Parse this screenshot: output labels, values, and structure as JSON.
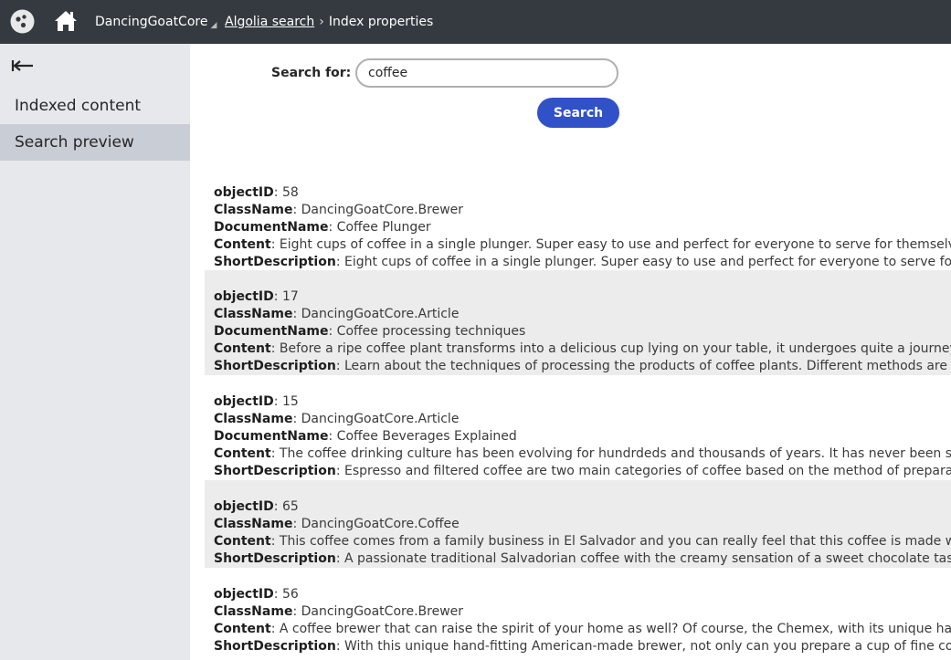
{
  "header": {
    "site": "DancingGoatCore",
    "breadcrumb_link": "Algolia search",
    "breadcrumb_current": "Index properties"
  },
  "sidebar": {
    "back_icon": "back-arrow-icon",
    "items": [
      {
        "label": "Indexed content"
      },
      {
        "label": "Search preview",
        "selected": true
      }
    ]
  },
  "search": {
    "label": "Search for:",
    "value": "coffee",
    "button": "Search"
  },
  "field_labels": {
    "objectID": "objectID",
    "ClassName": "ClassName",
    "DocumentName": "DocumentName",
    "Content": "Content",
    "ShortDescription": "ShortDescription",
    "separator": ": "
  },
  "results": [
    {
      "objectID": "58",
      "ClassName": "DancingGoatCore.Brewer",
      "DocumentName": "Coffee Plunger",
      "Content": "Eight cups of coffee in a single plunger. Super easy to use and perfect for everyone to serve for themselves.",
      "ShortDescription": "Eight cups of coffee in a single plunger. Super easy to use and perfect for everyone to serve for themselves."
    },
    {
      "objectID": "17",
      "ClassName": "DancingGoatCore.Article",
      "DocumentName": "Coffee processing techniques",
      "Content": "Before a ripe coffee plant transforms into a delicious cup lying on your table, it undergoes quite a journey. A journey full c",
      "ShortDescription": "Learn about the techniques of processing the products of coffee plants. Different methods are used in different"
    },
    {
      "objectID": "15",
      "ClassName": "DancingGoatCore.Article",
      "DocumentName": "Coffee Beverages Explained",
      "Content": "The coffee drinking culture has been evolving for hundrdeds and thousands of years. It has never been so rich as today. H",
      "ShortDescription": "Espresso and filtered coffee are two main categories of coffee based on the method of preparation. Learn about"
    },
    {
      "objectID": "65",
      "ClassName": "DancingGoatCore.Coffee",
      "Content": "This coffee comes from a family business in El Salvador and you can really feel that this coffee is made with a passion and",
      "ShortDescription": "A passionate traditional Salvadorian coffee with the creamy sensation of a sweet chocolate taste, suitable for all"
    },
    {
      "objectID": "56",
      "ClassName": "DancingGoatCore.Brewer",
      "Content": "A coffee brewer that can raise the spirit of your home as well? Of course, the Chemex, with its unique hand-fitting shape, t",
      "ShortDescription": "With this unique hand-fitting American-made brewer, not only can you prepare a cup of fine coffee, but you also"
    }
  ]
}
